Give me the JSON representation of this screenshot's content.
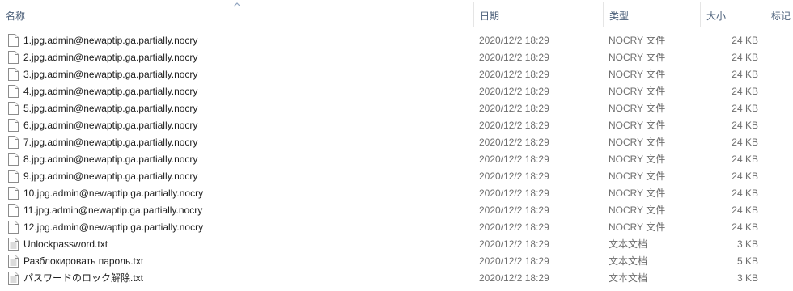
{
  "columns": {
    "name": "名称",
    "date": "日期",
    "type": "类型",
    "size": "大小",
    "tags": "标记"
  },
  "sort": {
    "column": "name",
    "direction": "ascending",
    "icon": "sort-up-icon"
  },
  "files": [
    {
      "name": "1.jpg.admin@newaptip.ga.partially.nocry",
      "date": "2020/12/2 18:29",
      "type": "NOCRY 文件",
      "size": "24 KB",
      "icon": "file-icon"
    },
    {
      "name": "2.jpg.admin@newaptip.ga.partially.nocry",
      "date": "2020/12/2 18:29",
      "type": "NOCRY 文件",
      "size": "24 KB",
      "icon": "file-icon"
    },
    {
      "name": "3.jpg.admin@newaptip.ga.partially.nocry",
      "date": "2020/12/2 18:29",
      "type": "NOCRY 文件",
      "size": "24 KB",
      "icon": "file-icon"
    },
    {
      "name": "4.jpg.admin@newaptip.ga.partially.nocry",
      "date": "2020/12/2 18:29",
      "type": "NOCRY 文件",
      "size": "24 KB",
      "icon": "file-icon"
    },
    {
      "name": "5.jpg.admin@newaptip.ga.partially.nocry",
      "date": "2020/12/2 18:29",
      "type": "NOCRY 文件",
      "size": "24 KB",
      "icon": "file-icon"
    },
    {
      "name": "6.jpg.admin@newaptip.ga.partially.nocry",
      "date": "2020/12/2 18:29",
      "type": "NOCRY 文件",
      "size": "24 KB",
      "icon": "file-icon"
    },
    {
      "name": "7.jpg.admin@newaptip.ga.partially.nocry",
      "date": "2020/12/2 18:29",
      "type": "NOCRY 文件",
      "size": "24 KB",
      "icon": "file-icon"
    },
    {
      "name": "8.jpg.admin@newaptip.ga.partially.nocry",
      "date": "2020/12/2 18:29",
      "type": "NOCRY 文件",
      "size": "24 KB",
      "icon": "file-icon"
    },
    {
      "name": "9.jpg.admin@newaptip.ga.partially.nocry",
      "date": "2020/12/2 18:29",
      "type": "NOCRY 文件",
      "size": "24 KB",
      "icon": "file-icon"
    },
    {
      "name": "10.jpg.admin@newaptip.ga.partially.nocry",
      "date": "2020/12/2 18:29",
      "type": "NOCRY 文件",
      "size": "24 KB",
      "icon": "file-icon"
    },
    {
      "name": "11.jpg.admin@newaptip.ga.partially.nocry",
      "date": "2020/12/2 18:29",
      "type": "NOCRY 文件",
      "size": "24 KB",
      "icon": "file-icon"
    },
    {
      "name": "12.jpg.admin@newaptip.ga.partially.nocry",
      "date": "2020/12/2 18:29",
      "type": "NOCRY 文件",
      "size": "24 KB",
      "icon": "file-icon"
    },
    {
      "name": "Unlockpassword.txt",
      "date": "2020/12/2 18:29",
      "type": "文本文档",
      "size": "3 KB",
      "icon": "text-file-icon"
    },
    {
      "name": "Разблокировать пароль.txt",
      "date": "2020/12/2 18:29",
      "type": "文本文档",
      "size": "5 KB",
      "icon": "text-file-icon"
    },
    {
      "name": "パスワードのロック解除.txt",
      "date": "2020/12/2 18:29",
      "type": "文本文档",
      "size": "3 KB",
      "icon": "text-file-icon"
    }
  ]
}
